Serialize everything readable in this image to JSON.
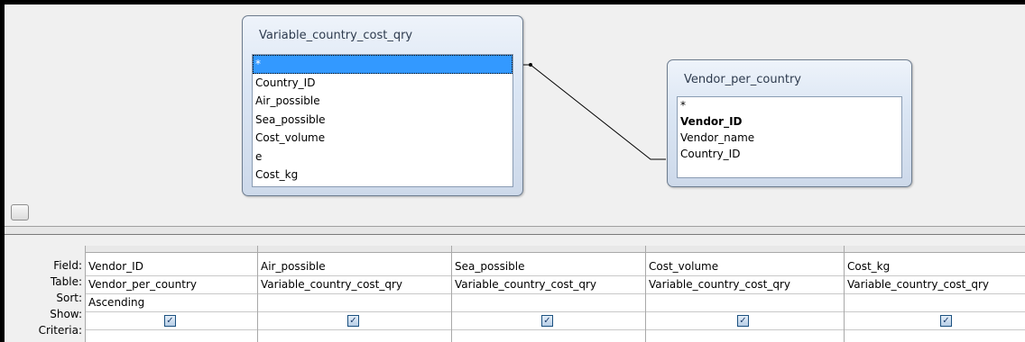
{
  "design": {
    "tables": [
      {
        "title": "Variable_country_cost_qry",
        "fields": [
          "*",
          "Country_ID",
          "Air_possible",
          "Sea_possible",
          "Cost_volume",
          "e",
          "Cost_kg"
        ]
      },
      {
        "title": "Vendor_per_country",
        "fields": [
          "*",
          "Vendor_ID",
          "Vendor_name",
          "Country_ID"
        ]
      }
    ]
  },
  "grid": {
    "row_labels": {
      "field": "Field:",
      "table": "Table:",
      "sort": "Sort:",
      "show": "Show:",
      "criteria": "Criteria:"
    },
    "columns": [
      {
        "field": "Vendor_ID",
        "table": "Vendor_per_country",
        "sort": "Ascending",
        "show": true
      },
      {
        "field": "Air_possible",
        "table": "Variable_country_cost_qry",
        "sort": "",
        "show": true
      },
      {
        "field": "Sea_possible",
        "table": "Variable_country_cost_qry",
        "sort": "",
        "show": true
      },
      {
        "field": "Cost_volume",
        "table": "Variable_country_cost_qry",
        "sort": "",
        "show": true
      },
      {
        "field": "Cost_kg",
        "table": "Variable_country_cost_qry",
        "sort": "",
        "show": true
      }
    ]
  }
}
